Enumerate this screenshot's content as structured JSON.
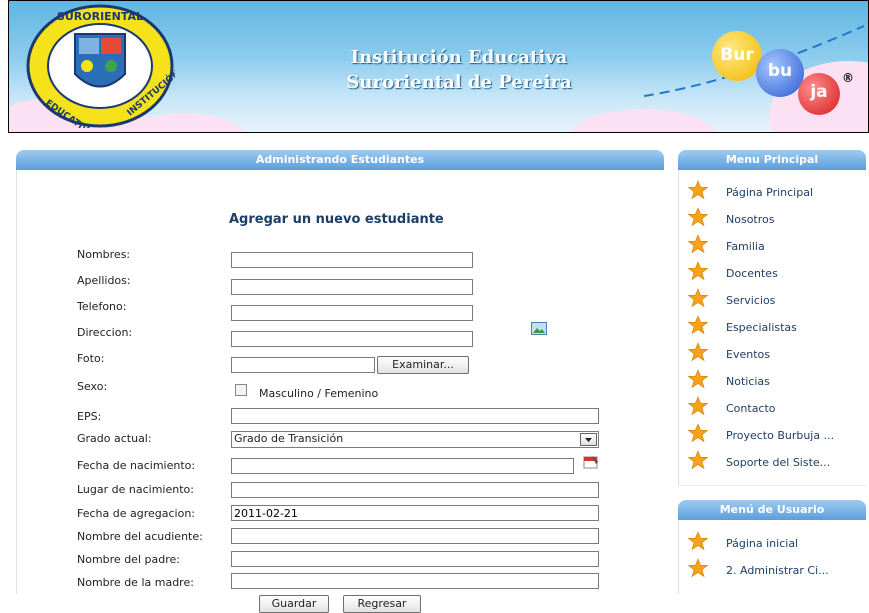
{
  "header": {
    "logo_text_top": "SURORIENTAL",
    "logo_text_left": "EDUCATIVA",
    "logo_text_right": "INSTITUCIÓN",
    "title_line1": "Institución Educativa",
    "title_line2": "Suroriental de Pereira",
    "brand": {
      "p1": "Bur",
      "p2": "bu",
      "p3": "ja",
      "reg": "®"
    }
  },
  "main": {
    "panel_title": "Administrando Estudiantes",
    "form_title": "Agregar un nuevo estudiante",
    "labels": {
      "nombres": "Nombres:",
      "apellidos": "Apellidos:",
      "telefono": "Telefono:",
      "direccion": "Direccion:",
      "foto": "Foto:",
      "sexo": "Sexo:",
      "eps": "EPS:",
      "grado": "Grado actual:",
      "fecha_nac": "Fecha de nacimiento:",
      "lugar_nac": "Lugar de nacimiento:",
      "fecha_agr": "Fecha de agregacion:",
      "acudiente": "Nombre del acudiente:",
      "padre": "Nombre del padre:",
      "madre": "Nombre de la madre:"
    },
    "values": {
      "nombres": "",
      "apellidos": "",
      "telefono": "",
      "direccion": "",
      "foto": "",
      "eps": "",
      "grado": "Grado de Transición",
      "fecha_nac": "",
      "lugar_nac": "",
      "fecha_agr": "2011-02-21",
      "acudiente": "",
      "padre": "",
      "madre": ""
    },
    "examinar_label": "Examinar...",
    "sexo_option": "Masculino / Femenino",
    "guardar_label": "Guardar",
    "regresar_label": "Regresar"
  },
  "sidebar": {
    "menu_title": "Menu Principal",
    "items": [
      "Página Principal",
      "Nosotros",
      "Familia",
      "Docentes",
      "Servicios",
      "Especialistas",
      "Eventos",
      "Noticias",
      "Contacto",
      "Proyecto Burbuja ...",
      "Soporte del Siste..."
    ],
    "user_title": "Menú de Usuario",
    "user_items": [
      "Página inicial",
      "2. Administrar Ci..."
    ]
  },
  "colors": {
    "panel_header": "#5d9ddd",
    "link": "#1d3f66",
    "star": "#f7a21b"
  }
}
